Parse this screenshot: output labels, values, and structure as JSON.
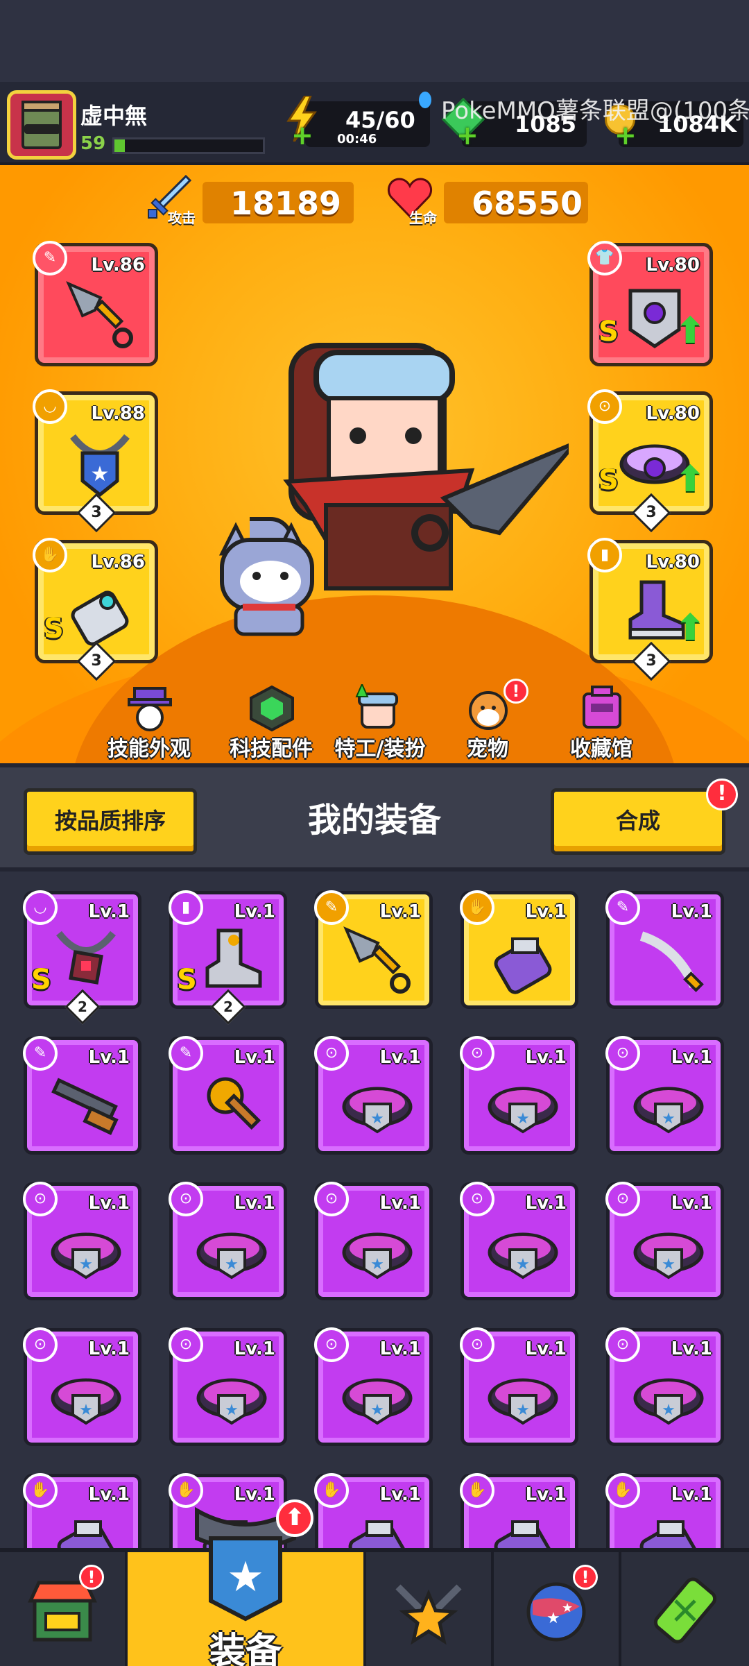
{
  "player": {
    "name": "虚中無",
    "level": "59",
    "xp_fraction": 0.07
  },
  "resources": {
    "energy": {
      "value": "45/60",
      "timer": "00:46",
      "icon": "lightning-bolt-icon"
    },
    "gems": {
      "value": "1085",
      "icon": "green-gem-icon"
    },
    "coins": {
      "value": "1084K",
      "icon": "gold-coin-icon"
    }
  },
  "overlay_text": "PokeMMO薯条联盟@(100条",
  "stats": {
    "attack": {
      "label": "攻击",
      "value": "18189",
      "icon": "sword-icon"
    },
    "hp": {
      "label": "生命",
      "value": "68550",
      "icon": "heart-icon"
    }
  },
  "equipped": {
    "weapon": {
      "level": "Lv.86",
      "icon": "kunai-icon"
    },
    "necklace": {
      "level": "Lv.88",
      "stars": "3",
      "icon": "necklace-icon"
    },
    "gloves": {
      "level": "Lv.86",
      "grade": "S",
      "stars": "3",
      "icon": "gauntlet-icon"
    },
    "armor": {
      "level": "Lv.80",
      "grade": "S",
      "icon": "armor-icon"
    },
    "belt": {
      "level": "Lv.80",
      "grade": "S",
      "stars": "3",
      "icon": "belt-icon"
    },
    "boots": {
      "level": "Lv.80",
      "stars": "3",
      "icon": "boots-icon"
    }
  },
  "hero_tabs": [
    {
      "label": "技能外观",
      "icon": "skill-skin-icon"
    },
    {
      "label": "科技配件",
      "icon": "tech-part-icon"
    },
    {
      "label": "特工/装扮",
      "icon": "agent-icon"
    },
    {
      "label": "宠物",
      "icon": "pet-icon",
      "badge": "!"
    },
    {
      "label": "收藏馆",
      "icon": "collection-icon"
    }
  ],
  "toolbar": {
    "sort_label": "按品质排序",
    "title": "我的装备",
    "merge_label": "合成",
    "merge_badge": "!"
  },
  "inventory": [
    {
      "level": "Lv.1",
      "rarity": "purple",
      "grade": "S",
      "stars": "2",
      "icon": "necklace-icon"
    },
    {
      "level": "Lv.1",
      "rarity": "purple",
      "grade": "S",
      "stars": "2",
      "icon": "boots-icon"
    },
    {
      "level": "Lv.1",
      "rarity": "yellow",
      "icon": "kunai-icon"
    },
    {
      "level": "Lv.1",
      "rarity": "yellow",
      "icon": "gauntlet-icon"
    },
    {
      "level": "Lv.1",
      "rarity": "purple",
      "icon": "sword-icon"
    },
    {
      "level": "Lv.1",
      "rarity": "purple",
      "icon": "shotgun-icon"
    },
    {
      "level": "Lv.1",
      "rarity": "purple",
      "icon": "torch-icon"
    },
    {
      "level": "Lv.1",
      "rarity": "purple",
      "icon": "belt-icon"
    },
    {
      "level": "Lv.1",
      "rarity": "purple",
      "icon": "belt-icon"
    },
    {
      "level": "Lv.1",
      "rarity": "purple",
      "icon": "belt-icon"
    },
    {
      "level": "Lv.1",
      "rarity": "purple",
      "icon": "belt-icon"
    },
    {
      "level": "Lv.1",
      "rarity": "purple",
      "icon": "belt-icon"
    },
    {
      "level": "Lv.1",
      "rarity": "purple",
      "icon": "belt-icon"
    },
    {
      "level": "Lv.1",
      "rarity": "purple",
      "icon": "belt-icon"
    },
    {
      "level": "Lv.1",
      "rarity": "purple",
      "icon": "belt-icon"
    },
    {
      "level": "Lv.1",
      "rarity": "purple",
      "icon": "belt-icon"
    },
    {
      "level": "Lv.1",
      "rarity": "purple",
      "icon": "belt-icon"
    },
    {
      "level": "Lv.1",
      "rarity": "purple",
      "icon": "belt-icon"
    },
    {
      "level": "Lv.1",
      "rarity": "purple",
      "icon": "belt-icon"
    },
    {
      "level": "Lv.1",
      "rarity": "purple",
      "icon": "belt-icon"
    },
    {
      "level": "Lv.1",
      "rarity": "purple",
      "icon": "gauntlet-icon"
    },
    {
      "level": "Lv.1",
      "rarity": "purple",
      "icon": "gauntlet-icon"
    },
    {
      "level": "Lv.1",
      "rarity": "purple",
      "icon": "gauntlet-icon"
    },
    {
      "level": "Lv.1",
      "rarity": "purple",
      "icon": "gauntlet-icon"
    },
    {
      "level": "Lv.1",
      "rarity": "purple",
      "icon": "gauntlet-icon"
    }
  ],
  "bottom_nav": [
    {
      "label": "",
      "icon": "shop-icon",
      "badge": "!"
    },
    {
      "label": "装备",
      "icon": "equipment-icon",
      "badge": "⬆",
      "active": true
    },
    {
      "label": "",
      "icon": "star-weapons-icon"
    },
    {
      "label": "",
      "icon": "planet-icon",
      "badge": "!"
    },
    {
      "label": "",
      "icon": "dna-capsule-icon"
    }
  ],
  "colors": {
    "hero_bg": "#ffad10",
    "purple": "#c23cf0",
    "yellow": "#ffd21c",
    "panel": "#2e3140"
  }
}
